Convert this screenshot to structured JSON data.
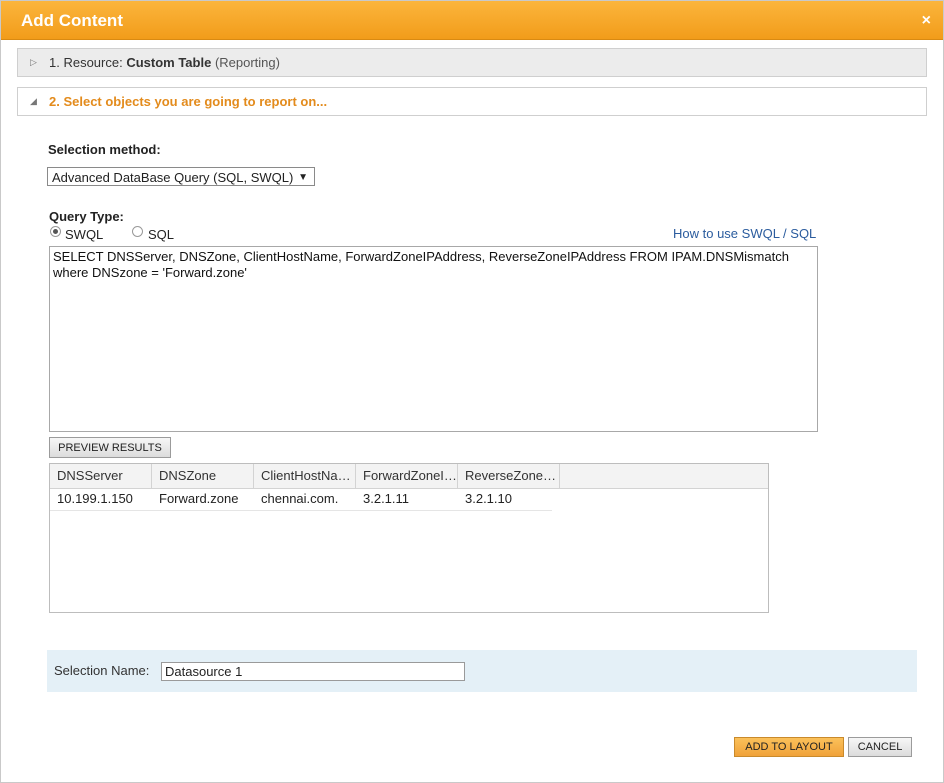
{
  "dialog": {
    "title": "Add Content",
    "close_glyph": "×"
  },
  "steps": {
    "step1": {
      "prefix": "1. Resource: ",
      "resource": "Custom Table",
      "suffix": " (Reporting)"
    },
    "step2": {
      "label": "2. Select objects you are going to report on..."
    }
  },
  "selection_method": {
    "label": "Selection method:",
    "value": "Advanced DataBase Query (SQL, SWQL)"
  },
  "query_type": {
    "label": "Query Type:",
    "options": [
      "SWQL",
      "SQL"
    ],
    "selected": "SWQL",
    "help_link": "How to use SWQL / SQL"
  },
  "query": {
    "text": "SELECT DNSServer, DNSZone, ClientHostName, ForwardZoneIPAddress, ReverseZoneIPAddress FROM IPAM.DNSMismatch\nwhere DNSzone = 'Forward.zone'"
  },
  "preview": {
    "button_label": "PREVIEW RESULTS",
    "columns": [
      "DNSServer",
      "DNSZone",
      "ClientHostName",
      "ForwardZoneIPAddress",
      "ReverseZoneIPAddress"
    ],
    "rows": [
      [
        "10.199.1.150",
        "Forward.zone",
        "chennai.com.",
        "3.2.1.11",
        "3.2.1.10"
      ]
    ]
  },
  "selection_name": {
    "label": "Selection Name:",
    "value": "Datasource 1"
  },
  "footer": {
    "add_label": "ADD TO LAYOUT",
    "cancel_label": "CANCEL"
  },
  "colors": {
    "title_bar": "#f5a623",
    "step2_text": "#e38b1c",
    "link": "#2b5c9e",
    "selection_bar": "#e4f0f7"
  }
}
